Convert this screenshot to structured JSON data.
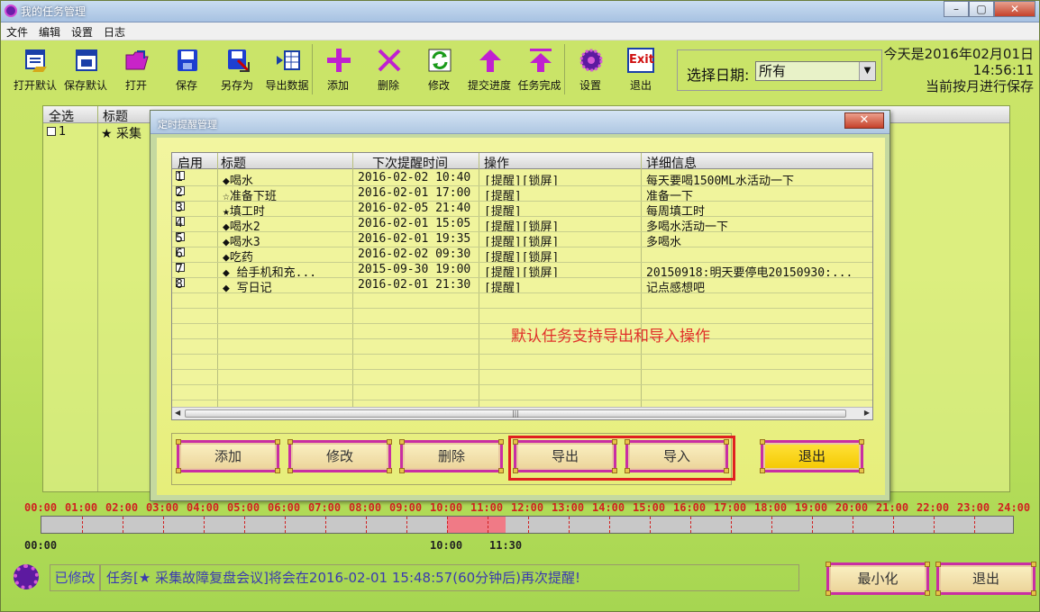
{
  "app": {
    "title": "我的任务管理"
  },
  "menu": [
    "文件",
    "编辑",
    "设置",
    "日志"
  ],
  "toolbar": [
    {
      "label": "打开默认",
      "icon": "open-default-icon"
    },
    {
      "label": "保存默认",
      "icon": "save-default-icon"
    },
    {
      "label": "打开",
      "icon": "folder-open-icon"
    },
    {
      "label": "保存",
      "icon": "floppy-icon"
    },
    {
      "label": "另存为",
      "icon": "save-as-icon"
    },
    {
      "label": "导出数据",
      "icon": "export-data-icon"
    },
    {
      "label": "添加",
      "icon": "plus-icon"
    },
    {
      "label": "删除",
      "icon": "x-icon"
    },
    {
      "label": "修改",
      "icon": "refresh-icon"
    },
    {
      "label": "提交进度",
      "icon": "arrow-up-icon"
    },
    {
      "label": "任务完成",
      "icon": "double-arrow-up-icon"
    },
    {
      "label": "设置",
      "icon": "gear-icon"
    },
    {
      "label": "退出",
      "icon": "exit-icon",
      "icon_text": "Exit"
    }
  ],
  "date_filter": {
    "label": "选择日期:",
    "value": "所有"
  },
  "today": {
    "date": "今天是2016年02月01日",
    "time": "14:56:11",
    "save_mode": "当前按月进行保存"
  },
  "bg_table": {
    "col1": "全选",
    "col2": "标题",
    "row_num": "1",
    "row_title": "★ 采集"
  },
  "dialog": {
    "title": "定时提醒管理",
    "headers": [
      "启用",
      "标题",
      "下次提醒时间",
      "操作",
      "详细信息"
    ],
    "rows": [
      {
        "num": "1",
        "title": "◆喝水",
        "time": "2016-02-02 10:40",
        "op": "[提醒][锁屏]",
        "detail": "每天要喝1500ML水活动一下"
      },
      {
        "num": "2",
        "title": "☆准备下班",
        "time": "2016-02-01 17:00",
        "op": "[提醒]",
        "detail": "准备一下"
      },
      {
        "num": "3",
        "title": "★填工时",
        "time": "2016-02-05 21:40",
        "op": "[提醒]",
        "detail": "每周填工时"
      },
      {
        "num": "4",
        "title": "◆喝水2",
        "time": "2016-02-01 15:05",
        "op": "[提醒][锁屏]",
        "detail": "多喝水活动一下"
      },
      {
        "num": "5",
        "title": "◆喝水3",
        "time": "2016-02-01 19:35",
        "op": "[提醒][锁屏]",
        "detail": "多喝水"
      },
      {
        "num": "6",
        "title": "◆吃药",
        "time": "2016-02-02 09:30",
        "op": "[提醒][锁屏]",
        "detail": ""
      },
      {
        "num": "7",
        "title": "◆ 给手机和充...",
        "time": "2015-09-30 19:00",
        "op": "[提醒][锁屏]",
        "detail": "20150918:明天要停电20150930:..."
      },
      {
        "num": "8",
        "title": "◆ 写日记",
        "time": "2016-02-01 21:30",
        "op": "[提醒]",
        "detail": "记点感想吧"
      }
    ],
    "hint": "默认任务支持导出和导入操作",
    "buttons": {
      "add": "添加",
      "edit": "修改",
      "delete": "删除",
      "export": "导出",
      "import": "导入",
      "exit": "退出"
    }
  },
  "timeline": {
    "hours": [
      "00:00",
      "01:00",
      "02:00",
      "03:00",
      "04:00",
      "05:00",
      "06:00",
      "07:00",
      "08:00",
      "09:00",
      "10:00",
      "11:00",
      "12:00",
      "13:00",
      "14:00",
      "15:00",
      "16:00",
      "17:00",
      "18:00",
      "19:00",
      "20:00",
      "21:00",
      "22:00",
      "23:00",
      "24:00"
    ],
    "start_label": "00:00",
    "range_start": "10:00",
    "range_end": "11:30"
  },
  "status": {
    "modified": "已修改",
    "message": "任务[★ 采集故障复盘会议]将会在2016-02-01 15:48:57(60分钟后)再次提醒!",
    "minimize": "最小化",
    "exit": "退出"
  }
}
